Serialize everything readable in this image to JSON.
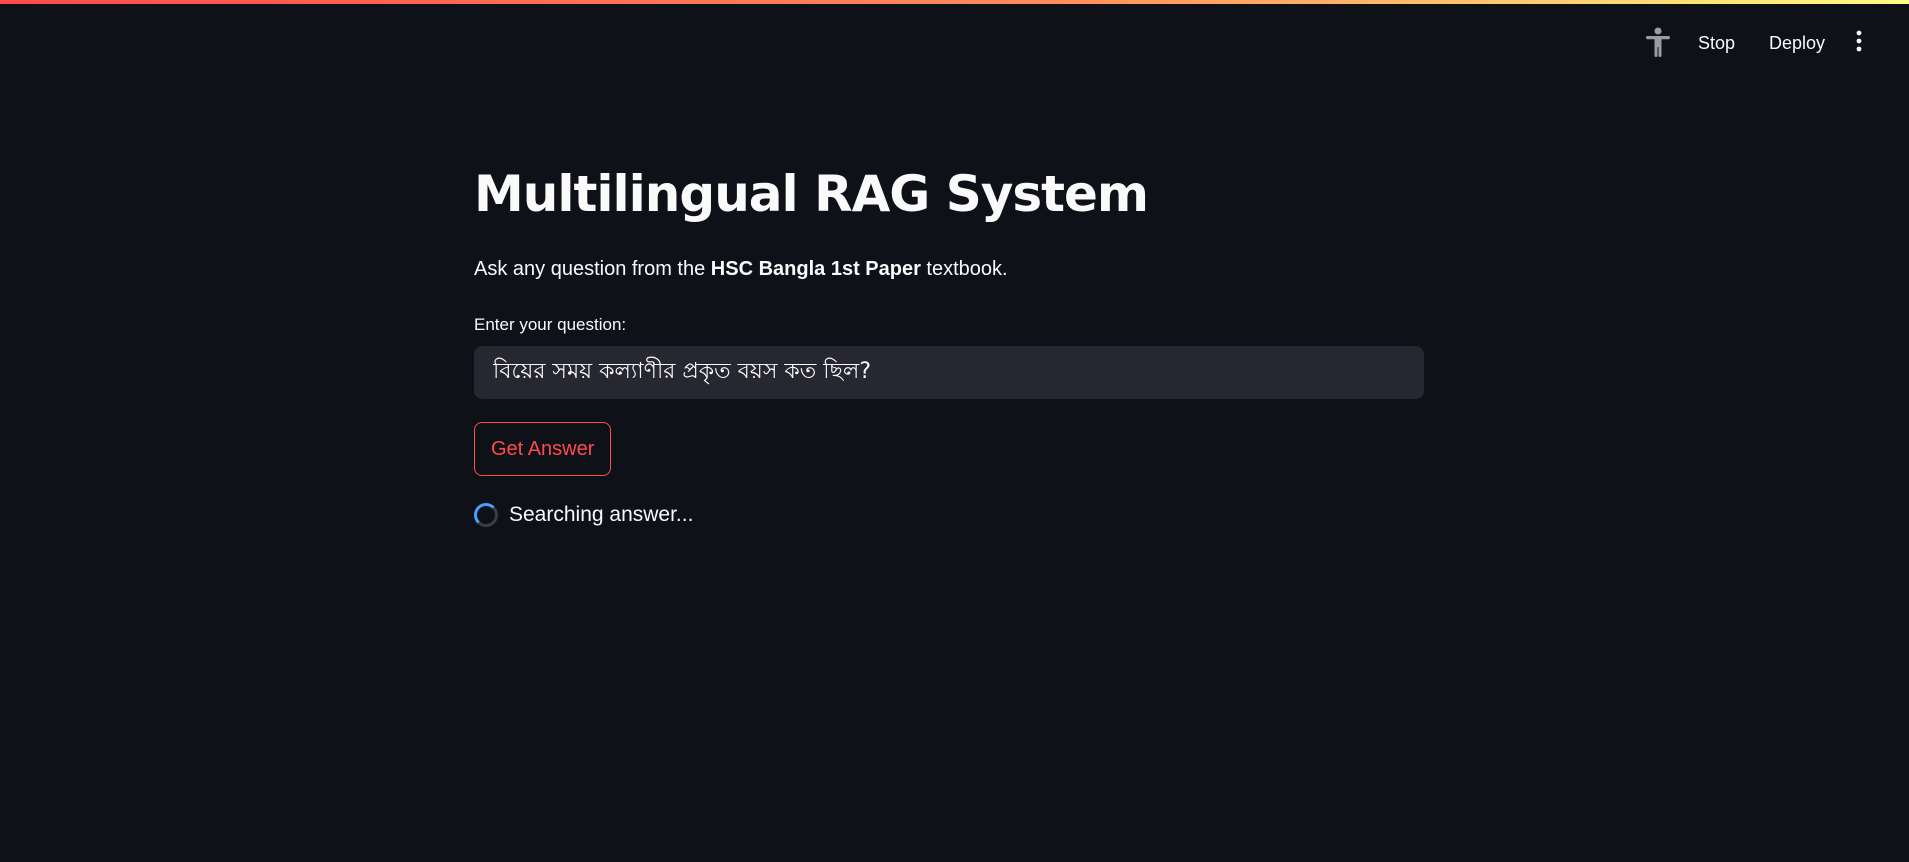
{
  "header": {
    "accessibility_icon": "accessibility-person-icon",
    "stop_label": "Stop",
    "deploy_label": "Deploy",
    "menu_icon": "vertical-ellipsis-icon"
  },
  "main": {
    "title": "Multilingual RAG System",
    "intro": {
      "before": "Ask any question from the ",
      "bold": "HSC Bangla 1st Paper",
      "after": " textbook."
    },
    "question_label": "Enter your question:",
    "question_value": "বিয়ের সময় কল্যাণীর প্রকৃত বয়স কত ছিল?",
    "submit_label": "Get Answer",
    "status_text": "Searching answer..."
  },
  "colors": {
    "background": "#0e1117",
    "input_background": "#262730",
    "accent": "#ff4b4b",
    "spinner": "#4a9eff",
    "text": "#fafafa"
  }
}
